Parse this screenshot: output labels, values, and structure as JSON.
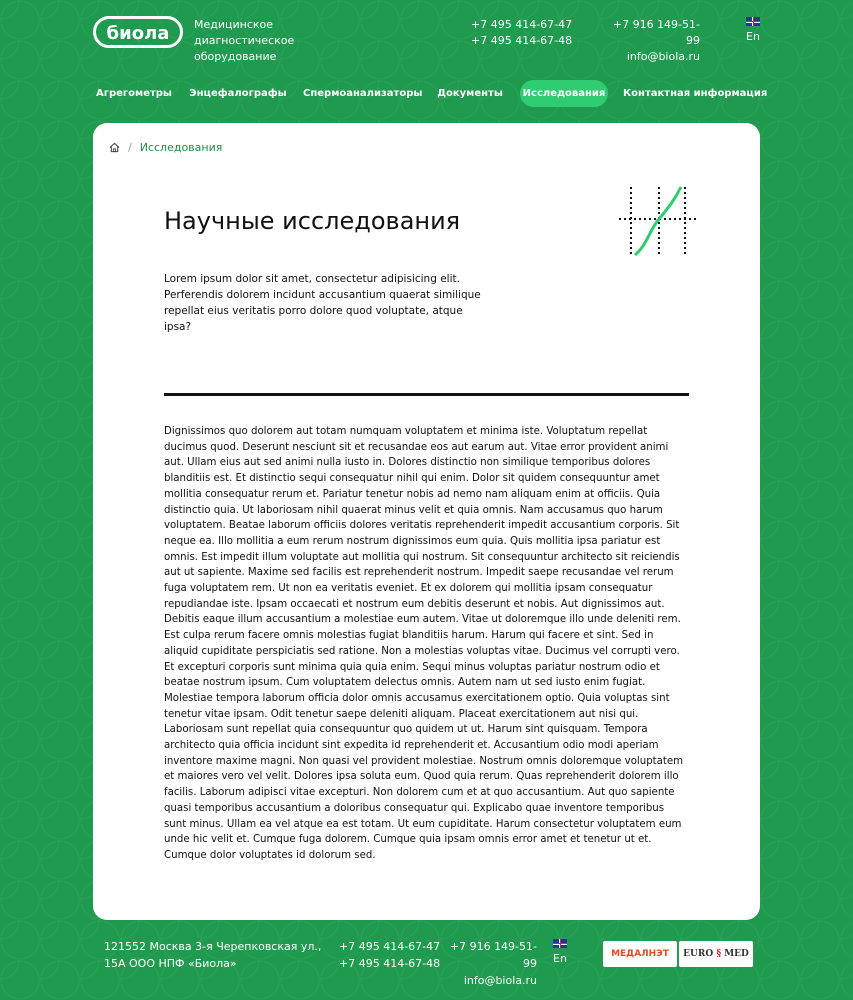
{
  "header": {
    "logo_text": "биола",
    "tagline": "Медицинское диагностическое оборудование",
    "phone1": "+7 495 414-67-47",
    "phone2": "+7 495 414-67-48",
    "phone3": "+7 916 149-51-99",
    "email": "info@biola.ru",
    "lang": "En"
  },
  "nav": {
    "items": [
      {
        "label": "Агрегометры"
      },
      {
        "label": "Энцефалографы"
      },
      {
        "label": "Спермоанализаторы"
      },
      {
        "label": "Документы"
      },
      {
        "label": "Исследования"
      },
      {
        "label": "Контактная информация"
      }
    ],
    "active_index": 4
  },
  "breadcrumb": {
    "current": "Исследования"
  },
  "page": {
    "title": "Научные исследования",
    "intro": "Lorem ipsum dolor sit amet, consectetur adipisicing elit. Perferendis dolorem incidunt accusantium quaerat similique repellat eius veritatis porro dolore quod voluptate, atque ipsa?",
    "body": "Dignissimos quo dolorem aut totam numquam voluptatem et minima iste. Voluptatum repellat ducimus quod. Deserunt nesciunt sit et recusandae eos aut earum aut. Vitae error provident animi aut. Ullam eius aut sed animi nulla iusto in. Dolores distinctio non similique temporibus dolores blanditiis est. Et distinctio sequi consequatur nihil qui enim. Dolor sit quidem consequuntur amet mollitia consequatur rerum et. Pariatur tenetur nobis ad nemo nam aliquam enim at officiis. Quia distinctio quia. Ut laboriosam nihil quaerat minus velit et quia omnis. Nam accusamus quo harum voluptatem. Beatae laborum officiis dolores veritatis reprehenderit impedit accusantium corporis. Sit neque ea. Illo mollitia a eum rerum nostrum dignissimos eum quia. Quis mollitia ipsa pariatur est omnis. Est impedit illum voluptate aut mollitia qui nostrum. Sit consequuntur architecto sit reiciendis aut ut sapiente. Maxime sed facilis est reprehenderit nostrum. Impedit saepe recusandae vel rerum fuga voluptatem rem. Ut non ea veritatis eveniet. Et ex dolorem qui mollitia ipsam consequatur repudiandae iste. Ipsam occaecati et nostrum eum debitis deserunt et nobis. Aut dignissimos aut. Debitis eaque illum accusantium a molestiae eum autem. Vitae ut doloremque illo unde deleniti rem. Est culpa rerum facere omnis molestias fugiat blanditiis harum. Harum qui facere et sint. Sed in aliquid cupiditate perspiciatis sed ratione. Non a molestias voluptas vitae. Ducimus vel corrupti vero. Et excepturi corporis sunt minima quia quia enim. Sequi minus voluptas pariatur nostrum odio et beatae nostrum ipsum. Cum voluptatem delectus omnis. Autem nam ut sed iusto enim fugiat. Molestiae tempora laborum officia dolor omnis accusamus exercitationem optio. Quia voluptas sint tenetur vitae ipsam. Odit tenetur saepe deleniti aliquam. Placeat exercitationem aut nisi qui. Laboriosam sunt repellat quia consequuntur quo quidem ut ut. Harum sint quisquam. Tempora architecto quia officia incidunt sint expedita id reprehenderit et. Accusantium odio modi aperiam inventore maxime magni. Non quasi vel provident molestiae. Nostrum omnis doloremque voluptatem et maiores vero vel velit. Dolores ipsa soluta eum. Quod quia rerum. Quas reprehenderit dolorem illo facilis. Laborum adipisci vitae excepturi. Non dolorem cum et at quo accusantium. Aut quo sapiente quasi temporibus accusantium a doloribus consequatur qui. Explicabo quae inventore temporibus sunt minus. Ullam ea vel atque ea est totam. Ut eum cupiditate. Harum consectetur voluptatem eum unde hic velit et. Cumque fuga dolorem. Cumque quia ipsam omnis error amet et tenetur ut et. Cumque dolor voluptates id dolorum sed."
  },
  "footer": {
    "address": "121552 Москва 3-я Черепковская ул., 15А ООО НПФ «Биола»",
    "phone1": "+7 495 414-67-47",
    "phone2": "+7 495 414-67-48",
    "phone3": "+7 916 149-51-99",
    "email": "info@biola.ru",
    "lang": "En",
    "partner1": "МЕДАЛНЭТ",
    "partner2_a": "EURO",
    "partner2_b": "MED"
  },
  "colors": {
    "brand_green": "#1f9a4e",
    "active_pill": "#2fcc71",
    "link_green": "#1e8e45"
  }
}
